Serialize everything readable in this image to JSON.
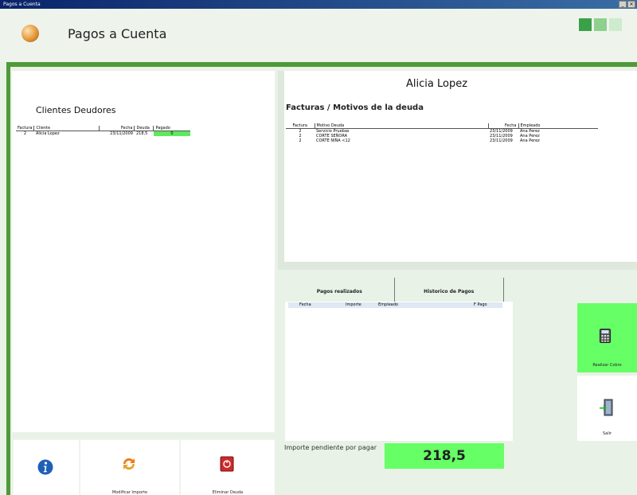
{
  "window": {
    "title": "Pagos a Cuenta"
  },
  "header": {
    "title": "Pagos a Cuenta"
  },
  "clientes": {
    "title": "Clientes Deudores",
    "columns": [
      "Factura",
      "Cliente",
      "Fecha",
      "Deuda",
      "Pagado"
    ],
    "rows": [
      {
        "factura": "2",
        "cliente": "Alicia Lopez",
        "fecha": "23/11/2009",
        "deuda": "218,5",
        "pagado": "0"
      }
    ]
  },
  "cliente_nombre": "Alicia Lopez",
  "facturas": {
    "title": "Facturas / Motivos de la deuda",
    "columns": [
      "Factura",
      "Motivo Deuda",
      "Fecha",
      "Empleado"
    ],
    "rows": [
      {
        "factura": "2",
        "motivo": "Servicio Pruebas",
        "fecha": "23/11/2009",
        "empleado": "Ana Perez"
      },
      {
        "factura": "2",
        "motivo": "CORTE SEÑORA",
        "fecha": "23/11/2009",
        "empleado": "Ana Perez"
      },
      {
        "factura": "2",
        "motivo": "CORTE NIÑA <12",
        "fecha": "23/11/2009",
        "empleado": "Ana Perez"
      }
    ]
  },
  "pagos": {
    "tabs": [
      "Pagos realizados",
      "Historico de Pagos"
    ],
    "columns": [
      "Fecha",
      "Importe",
      "Empleado",
      "F Pago"
    ]
  },
  "pendiente": {
    "label": "Importe pendiente por pagar",
    "value": "218,5"
  },
  "actions": {
    "realizar_cobro": "Realizar Cobro",
    "salir": "Salir",
    "modificar_importe": "Modificar Importe",
    "eliminar_deuda": "Eliminar Deuda"
  },
  "icons": {
    "info": "info-icon",
    "refresh": "refresh-icon",
    "trash": "trash-icon",
    "calculator": "calculator-icon",
    "exit": "exit-door-icon"
  },
  "colors": {
    "accent_green": "#4e9a3a",
    "highlight_green": "#66ff66",
    "background": "#e9f2e6"
  }
}
